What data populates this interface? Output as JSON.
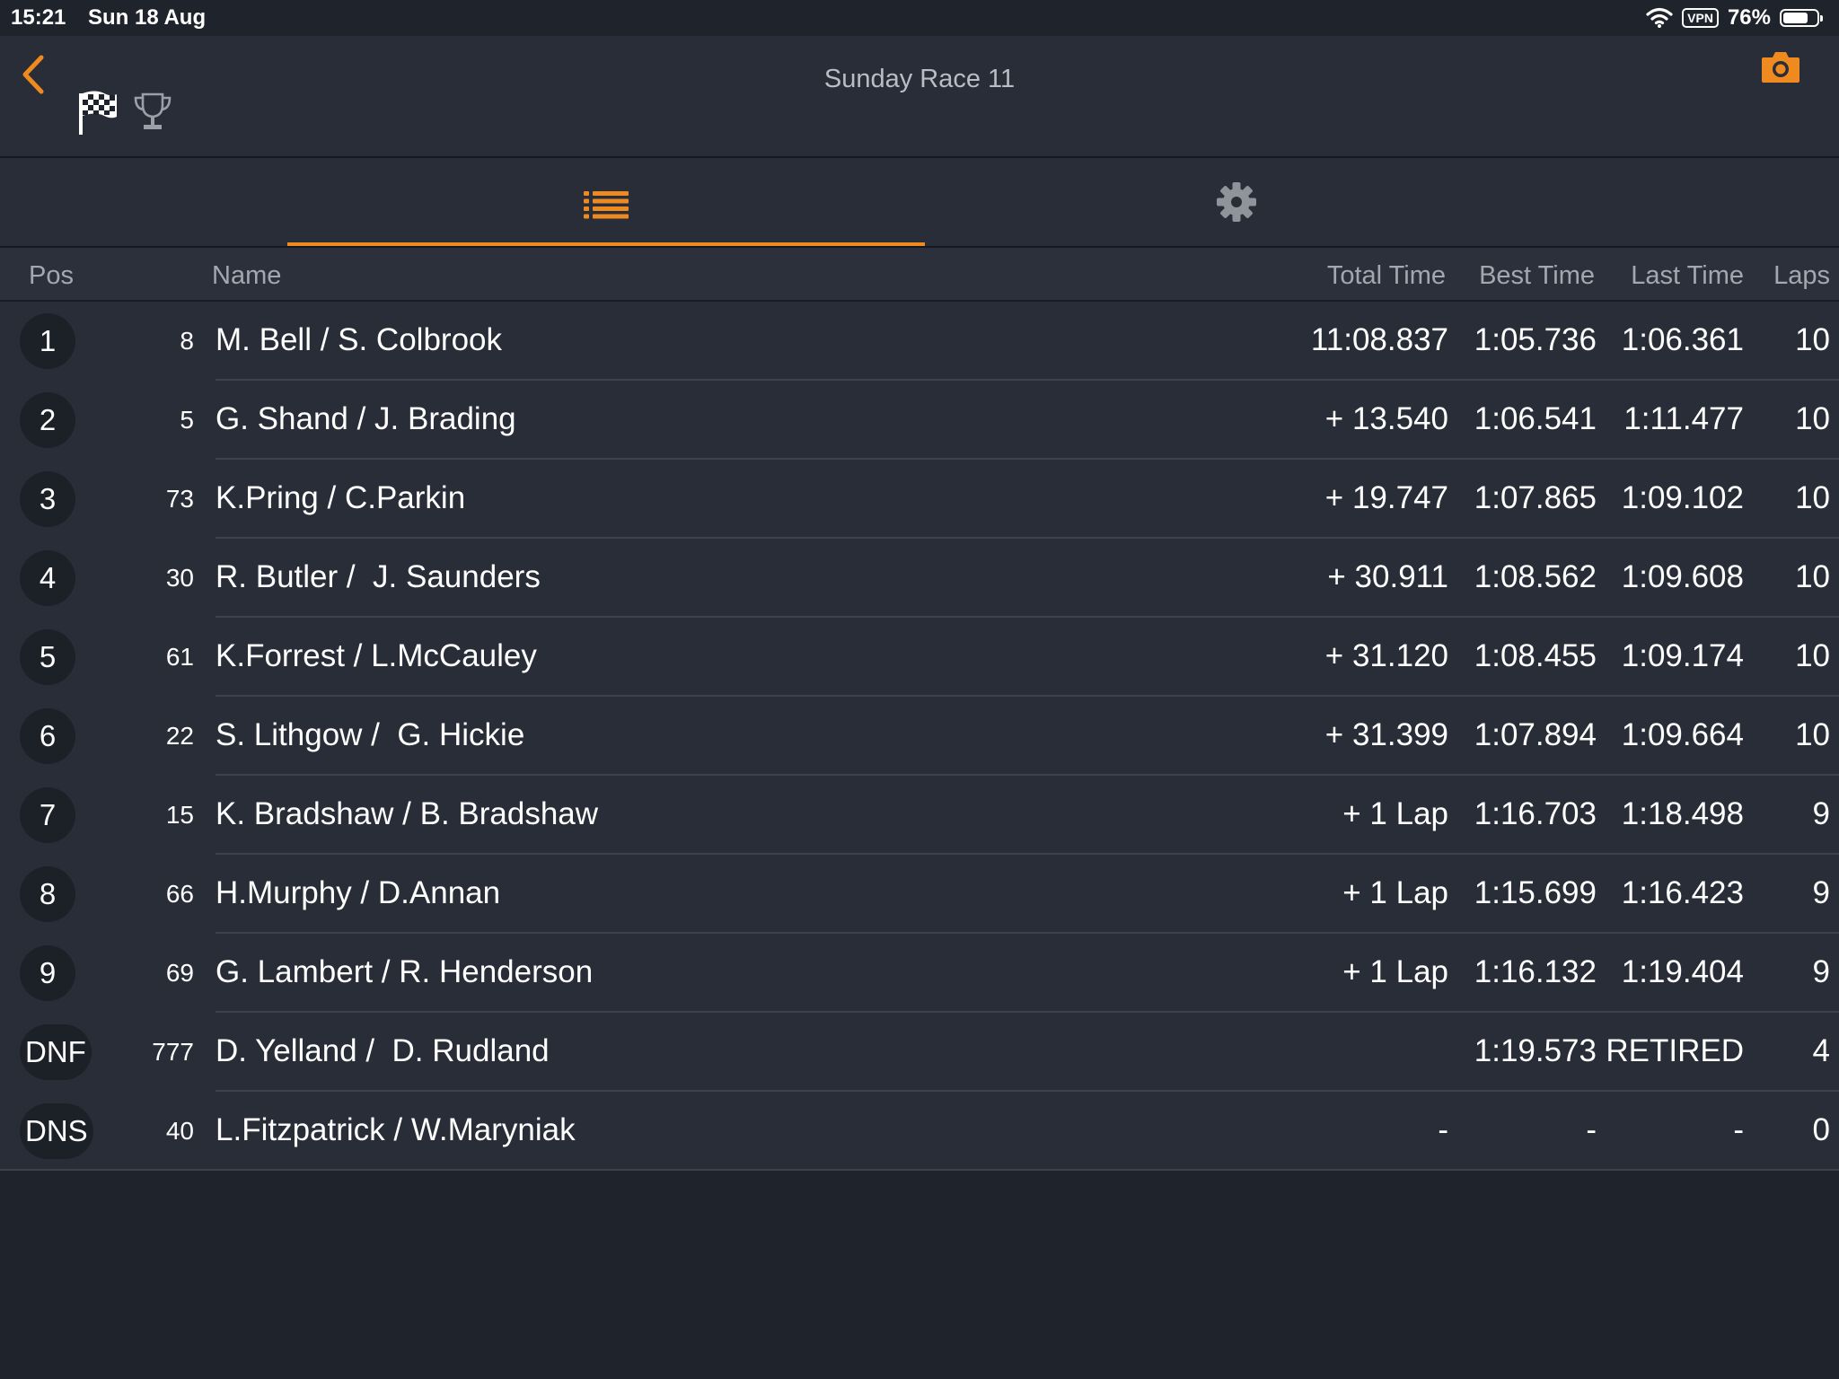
{
  "status": {
    "time": "15:21",
    "date": "Sun 18 Aug",
    "vpn": "VPN",
    "battery": "76%",
    "battery_level": 0.76
  },
  "nav": {
    "title": "Sunday Race 11"
  },
  "colors": {
    "accent": "#ee8a1f",
    "background": "#1f232b",
    "row": "#282d37"
  },
  "tabs": [
    {
      "icon": "list-icon",
      "selected": true
    },
    {
      "icon": "gear-icon",
      "selected": false
    }
  ],
  "table": {
    "headers": {
      "pos": "Pos",
      "name": "Name",
      "total": "Total Time",
      "best": "Best Time",
      "last": "Last Time",
      "laps": "Laps"
    },
    "rows": [
      {
        "pos": "1",
        "num": "8",
        "name": "M. Bell / S. Colbrook",
        "total": "11:08.837",
        "best": "1:05.736",
        "last": "1:06.361",
        "laps": "10"
      },
      {
        "pos": "2",
        "num": "5",
        "name": "G. Shand / J. Brading",
        "total": "+ 13.540",
        "best": "1:06.541",
        "last": "1:11.477",
        "laps": "10"
      },
      {
        "pos": "3",
        "num": "73",
        "name": "K.Pring / C.Parkin",
        "total": "+ 19.747",
        "best": "1:07.865",
        "last": "1:09.102",
        "laps": "10"
      },
      {
        "pos": "4",
        "num": "30",
        "name": "R. Butler /  J. Saunders",
        "total": "+ 30.911",
        "best": "1:08.562",
        "last": "1:09.608",
        "laps": "10"
      },
      {
        "pos": "5",
        "num": "61",
        "name": "K.Forrest / L.McCauley",
        "total": "+ 31.120",
        "best": "1:08.455",
        "last": "1:09.174",
        "laps": "10"
      },
      {
        "pos": "6",
        "num": "22",
        "name": "S. Lithgow /  G. Hickie",
        "total": "+ 31.399",
        "best": "1:07.894",
        "last": "1:09.664",
        "laps": "10"
      },
      {
        "pos": "7",
        "num": "15",
        "name": "K. Bradshaw / B. Bradshaw",
        "total": "+ 1 Lap",
        "best": "1:16.703",
        "last": "1:18.498",
        "laps": "9"
      },
      {
        "pos": "8",
        "num": "66",
        "name": "H.Murphy / D.Annan",
        "total": "+ 1 Lap",
        "best": "1:15.699",
        "last": "1:16.423",
        "laps": "9"
      },
      {
        "pos": "9",
        "num": "69",
        "name": "G. Lambert / R. Henderson",
        "total": "+ 1 Lap",
        "best": "1:16.132",
        "last": "1:19.404",
        "laps": "9"
      },
      {
        "pos": "DNF",
        "num": "777",
        "name": "D. Yelland /  D. Rudland",
        "total": "",
        "best": "1:19.573",
        "last": "RETIRED",
        "laps": "4"
      },
      {
        "pos": "DNS",
        "num": "40",
        "name": "L.Fitzpatrick / W.Maryniak",
        "total": "-",
        "best": "-",
        "last": "-",
        "laps": "0"
      }
    ]
  }
}
